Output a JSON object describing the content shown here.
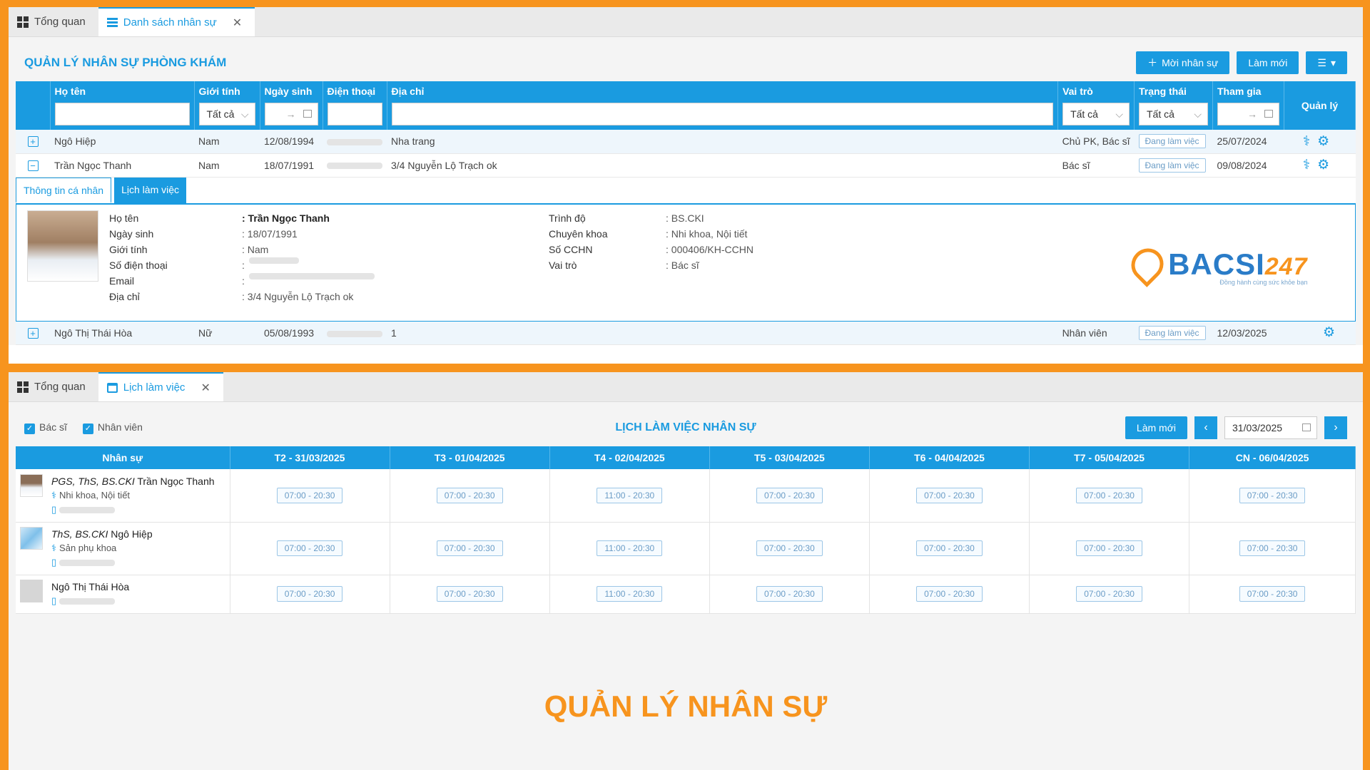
{
  "top": {
    "tabs": [
      {
        "label": "Tổng quan"
      },
      {
        "label": "Danh sách nhân sự"
      }
    ],
    "title": "QUẢN LÝ NHÂN SỰ PHÒNG KHÁM",
    "buttons": {
      "add": "Mời nhân sự",
      "refresh": "Làm mới"
    },
    "columns": [
      "Họ tên",
      "Giới tính",
      "Ngày sinh",
      "Điện thoại",
      "Địa chỉ",
      "Vai trò",
      "Trạng thái",
      "Tham gia",
      "Quản lý"
    ],
    "filters": {
      "gender": "Tất cả",
      "role": "Tất cả",
      "status": "Tất cả",
      "range_sep": "→"
    },
    "rows": [
      {
        "name": "Ngô Hiệp",
        "gender": "Nam",
        "dob": "12/08/1994",
        "address": "Nha trang",
        "role": "Chủ PK, Bác sĩ",
        "status": "Đang làm việc",
        "joined": "25/07/2024"
      },
      {
        "name": "Trần Ngọc Thanh",
        "gender": "Nam",
        "dob": "18/07/1991",
        "address": "3/4 Nguyễn Lộ Trạch ok",
        "role": "Bác sĩ",
        "status": "Đang làm việc",
        "joined": "09/08/2024"
      },
      {
        "name": "Ngô Thị Thái Hòa",
        "gender": "Nữ",
        "dob": "05/08/1993",
        "address": "1",
        "role": "Nhân viên",
        "status": "Đang làm việc",
        "joined": "12/03/2025"
      }
    ],
    "detail": {
      "tabs": [
        "Thông tin cá nhân",
        "Lịch làm việc"
      ],
      "left": [
        {
          "k": "Họ tên",
          "v": ": Trần Ngọc Thanh"
        },
        {
          "k": "Ngày sinh",
          "v": ": 18/07/1991"
        },
        {
          "k": "Giới tính",
          "v": ": Nam"
        },
        {
          "k": "Số điện thoại",
          "v": ":"
        },
        {
          "k": "Email",
          "v": ":"
        },
        {
          "k": "Địa chỉ",
          "v": ": 3/4 Nguyễn Lộ Trạch ok"
        }
      ],
      "right": [
        {
          "k": "Trình độ",
          "v": ": BS.CKI"
        },
        {
          "k": "Chuyên khoa",
          "v": ": Nhi khoa, Nội tiết"
        },
        {
          "k": "Số CCHN",
          "v": ": 000406/KH-CCHN"
        },
        {
          "k": "Vai trò",
          "v": ": Bác sĩ"
        }
      ],
      "logo": {
        "main": "BACSI",
        "num": "247",
        "tagline": "Đồng hành cùng sức khỏe bạn"
      }
    }
  },
  "bottom": {
    "tabs": [
      {
        "label": "Tổng quan"
      },
      {
        "label": "Lịch làm việc"
      }
    ],
    "checks": [
      "Bác sĩ",
      "Nhân viên"
    ],
    "title": "LỊCH LÀM VIỆC NHÂN SỰ",
    "refresh": "Làm mới",
    "date": "31/03/2025",
    "columns": [
      "Nhân sự",
      "T2 - 31/03/2025",
      "T3 - 01/04/2025",
      "T4 - 02/04/2025",
      "T5 - 03/04/2025",
      "T6 - 04/04/2025",
      "T7 - 05/04/2025",
      "CN - 06/04/2025"
    ],
    "staff": [
      {
        "title": "PGS, ThS, BS.CKI",
        "name": "Trần Ngọc Thanh",
        "specialty": "Nhi khoa, Nội tiết",
        "slots": [
          "07:00 - 20:30",
          "07:00 - 20:30",
          "11:00 - 20:30",
          "07:00 - 20:30",
          "07:00 - 20:30",
          "07:00 - 20:30",
          "07:00 - 20:30"
        ]
      },
      {
        "title": "ThS, BS.CKI",
        "name": "Ngô Hiệp",
        "specialty": "Sản phụ khoa",
        "slots": [
          "07:00 - 20:30",
          "07:00 - 20:30",
          "11:00 - 20:30",
          "07:00 - 20:30",
          "07:00 - 20:30",
          "07:00 - 20:30",
          "07:00 - 20:30"
        ]
      },
      {
        "title": "",
        "name": "Ngô Thị Thái Hòa",
        "specialty": "",
        "slots": [
          "07:00 - 20:30",
          "07:00 - 20:30",
          "11:00 - 20:30",
          "07:00 - 20:30",
          "07:00 - 20:30",
          "07:00 - 20:30",
          "07:00 - 20:30"
        ]
      }
    ]
  },
  "footer_title": "QUẢN LÝ NHÂN SỰ",
  "colors": {
    "accent": "#1a9be0",
    "brand": "#f7941e"
  }
}
